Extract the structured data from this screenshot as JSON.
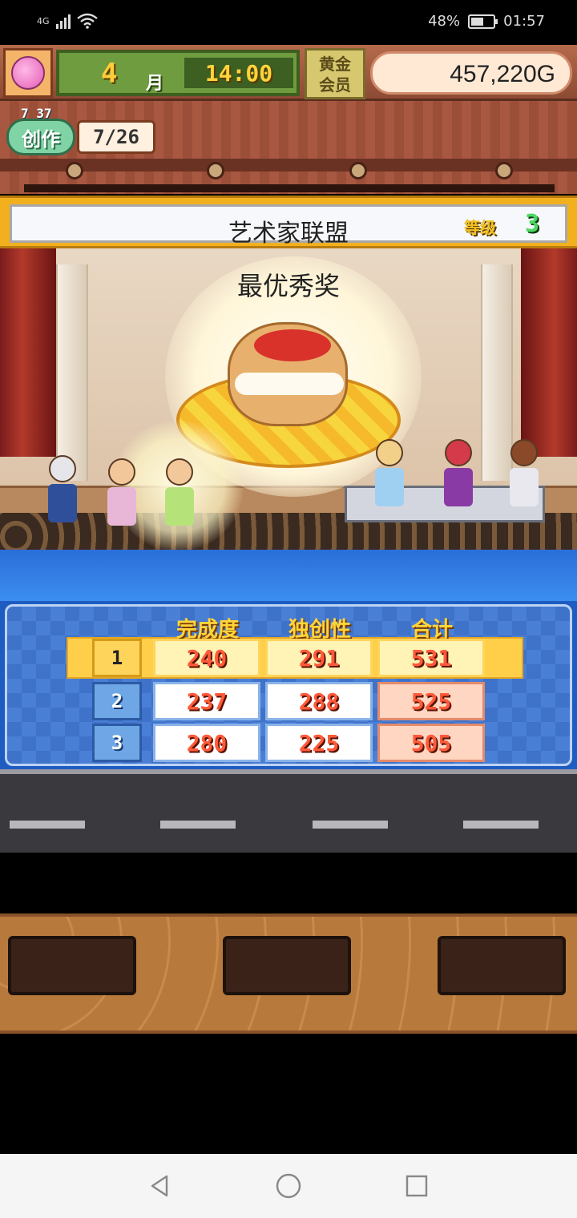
{
  "status_bar": {
    "network": "4G",
    "battery": "48%",
    "time": "01:57"
  },
  "hud": {
    "month": "4",
    "month_label": "月",
    "time": "14:00",
    "gold_member_badge": "黄金会员",
    "money": "457,220G"
  },
  "create": {
    "small_value": "7 37",
    "label": "创作",
    "count": "7/26"
  },
  "title_bar": {
    "title": "艺术家联盟",
    "level_label": "等级",
    "level_value": "3"
  },
  "stage": {
    "award": "最优秀奖"
  },
  "score_table": {
    "headers": [
      "完成度",
      "独创性",
      "合计"
    ],
    "rows": [
      {
        "rank": "1",
        "completion": "240",
        "originality": "291",
        "total": "531"
      },
      {
        "rank": "2",
        "completion": "237",
        "originality": "288",
        "total": "525"
      },
      {
        "rank": "3",
        "completion": "280",
        "originality": "225",
        "total": "505"
      }
    ]
  },
  "colors": {
    "accent_gold": "#ffd53a",
    "score_red": "#ff5a3a",
    "panel_blue": "#1e5cc2"
  },
  "nav": {
    "back_icon": "back-icon",
    "home_icon": "home-icon",
    "recents_icon": "recents-icon"
  }
}
